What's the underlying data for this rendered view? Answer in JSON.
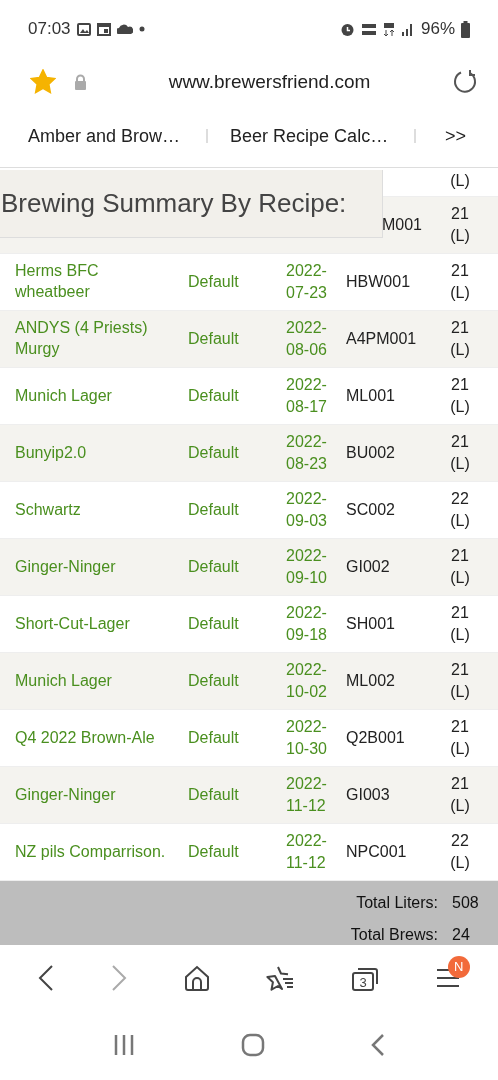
{
  "status_bar": {
    "time": "07:03",
    "battery": "96%"
  },
  "address_bar": {
    "url": "www.brewersfriend.com",
    "bookmarked": true
  },
  "bookmark_tabs": [
    {
      "label": "Amber and Brow…"
    },
    {
      "label": "Beer Recipe Calc…"
    }
  ],
  "bookmark_more": ">>",
  "page": {
    "title": "Brewing Summary By Recipe:",
    "rows": [
      {
        "kind": "partial",
        "volume": "(L)"
      },
      {
        "kind": "partial",
        "code": "M001",
        "volume": "21 (L)"
      },
      {
        "kind": "recipe",
        "name": "Herms BFC wheatbeer",
        "profile": "Default",
        "date": "2022-07-23",
        "code": "HBW001",
        "volume": "21 (L)"
      },
      {
        "kind": "recipe",
        "name": "ANDYS (4 Priests) Murgy",
        "profile": "Default",
        "date": "2022-08-06",
        "code": "A4PM001",
        "volume": "21 (L)"
      },
      {
        "kind": "recipe",
        "name": "Munich Lager",
        "profile": "Default",
        "date": "2022-08-17",
        "code": "ML001",
        "volume": "21 (L)"
      },
      {
        "kind": "recipe",
        "name": "Bunyip2.0",
        "profile": "Default",
        "date": "2022-08-23",
        "code": "BU002",
        "volume": "21 (L)"
      },
      {
        "kind": "recipe",
        "name": "Schwartz",
        "profile": "Default",
        "date": "2022-09-03",
        "code": "SC002",
        "volume": "22 (L)"
      },
      {
        "kind": "recipe",
        "name": "Ginger-Ninger",
        "profile": "Default",
        "date": "2022-09-10",
        "code": "GI002",
        "volume": "21 (L)"
      },
      {
        "kind": "recipe",
        "name": "Short-Cut-Lager",
        "profile": "Default",
        "date": "2022-09-18",
        "code": "SH001",
        "volume": "21 (L)"
      },
      {
        "kind": "recipe",
        "name": "Munich Lager",
        "profile": "Default",
        "date": "2022-10-02",
        "code": "ML002",
        "volume": "21 (L)"
      },
      {
        "kind": "recipe",
        "name": "Q4 2022 Brown-Ale",
        "profile": "Default",
        "date": "2022-10-30",
        "code": "Q2B001",
        "volume": "21 (L)"
      },
      {
        "kind": "recipe",
        "name": "Ginger-Ninger",
        "profile": "Default",
        "date": "2022-11-12",
        "code": "GI003",
        "volume": "21 (L)"
      },
      {
        "kind": "recipe",
        "name": "NZ pils Comparrison.",
        "profile": "Default",
        "date": "2022-11-12",
        "code": "NPC001",
        "volume": "22 (L)"
      }
    ],
    "totals": [
      {
        "label": "Total Liters:",
        "value": "508"
      },
      {
        "label": "Total Brews:",
        "value": "24"
      }
    ]
  },
  "bottom_nav": {
    "forward_disabled": true,
    "tab_count": "3",
    "menu_badge": "N"
  }
}
